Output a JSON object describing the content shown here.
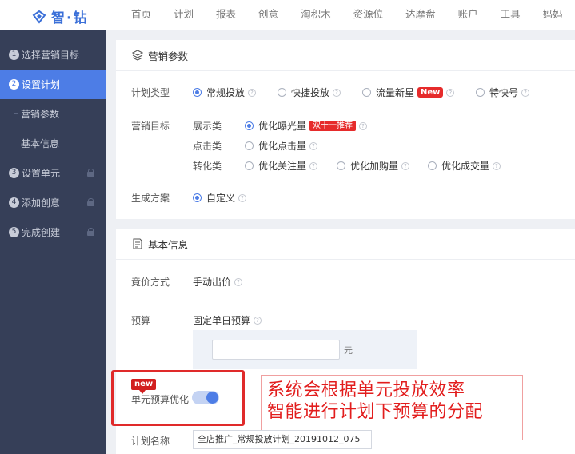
{
  "brand": {
    "name": "智·钻",
    "color": "#3a6fd8"
  },
  "nav": [
    "首页",
    "计划",
    "报表",
    "创意",
    "淘积木",
    "资源位",
    "达摩盘",
    "账户",
    "工具",
    "妈妈"
  ],
  "sidebar": {
    "steps": [
      {
        "num": "1",
        "label": "选择营销目标",
        "active": false,
        "locked": false
      },
      {
        "num": "2",
        "label": "设置计划",
        "active": true,
        "locked": false
      },
      {
        "num": "",
        "label": "营销参数",
        "sub": true
      },
      {
        "num": "",
        "label": "基本信息",
        "sub": true
      },
      {
        "num": "3",
        "label": "设置单元",
        "active": false,
        "locked": true
      },
      {
        "num": "4",
        "label": "添加创意",
        "active": false,
        "locked": true
      },
      {
        "num": "5",
        "label": "完成创建",
        "active": false,
        "locked": true
      }
    ]
  },
  "marketing": {
    "title": "营销参数",
    "plan_type_label": "计划类型",
    "plan_types": [
      {
        "label": "常规投放",
        "selected": true
      },
      {
        "label": "快捷投放",
        "selected": false
      },
      {
        "label": "流量新星",
        "selected": false,
        "badge": "New"
      },
      {
        "label": "特快号",
        "selected": false
      }
    ],
    "goal_label": "营销目标",
    "goal_groups": [
      {
        "name": "展示类",
        "options": [
          {
            "label": "优化曝光量",
            "selected": true,
            "badge": "双十一推荐"
          }
        ]
      },
      {
        "name": "点击类",
        "options": [
          {
            "label": "优化点击量",
            "selected": false
          }
        ]
      },
      {
        "name": "转化类",
        "options": [
          {
            "label": "优化关注量",
            "selected": false
          },
          {
            "label": "优化加购量",
            "selected": false
          },
          {
            "label": "优化成交量",
            "selected": false
          }
        ]
      }
    ],
    "scheme_label": "生成方案",
    "scheme_option": "自定义"
  },
  "basic": {
    "title": "基本信息",
    "bid_label": "竟价方式",
    "bid_value": "手动出价",
    "budget_label": "预算",
    "budget_type": "固定单日预算",
    "budget_value": "",
    "budget_unit": "元",
    "unit_opt_tag": "new",
    "unit_opt_label": "单元预算优化",
    "unit_opt_enabled": true,
    "plan_name_label": "计划名称",
    "plan_name_value": "全店推广_常规投放计划_20191012_075"
  },
  "callout": {
    "line1": "系统会根据单元投放效率",
    "line2": "智能进行计划下预算的分配",
    "color": "#e21d1d"
  },
  "colors": {
    "accent": "#4d7de6",
    "sidebar_bg": "#363f58",
    "alert": "#e62b2b"
  }
}
